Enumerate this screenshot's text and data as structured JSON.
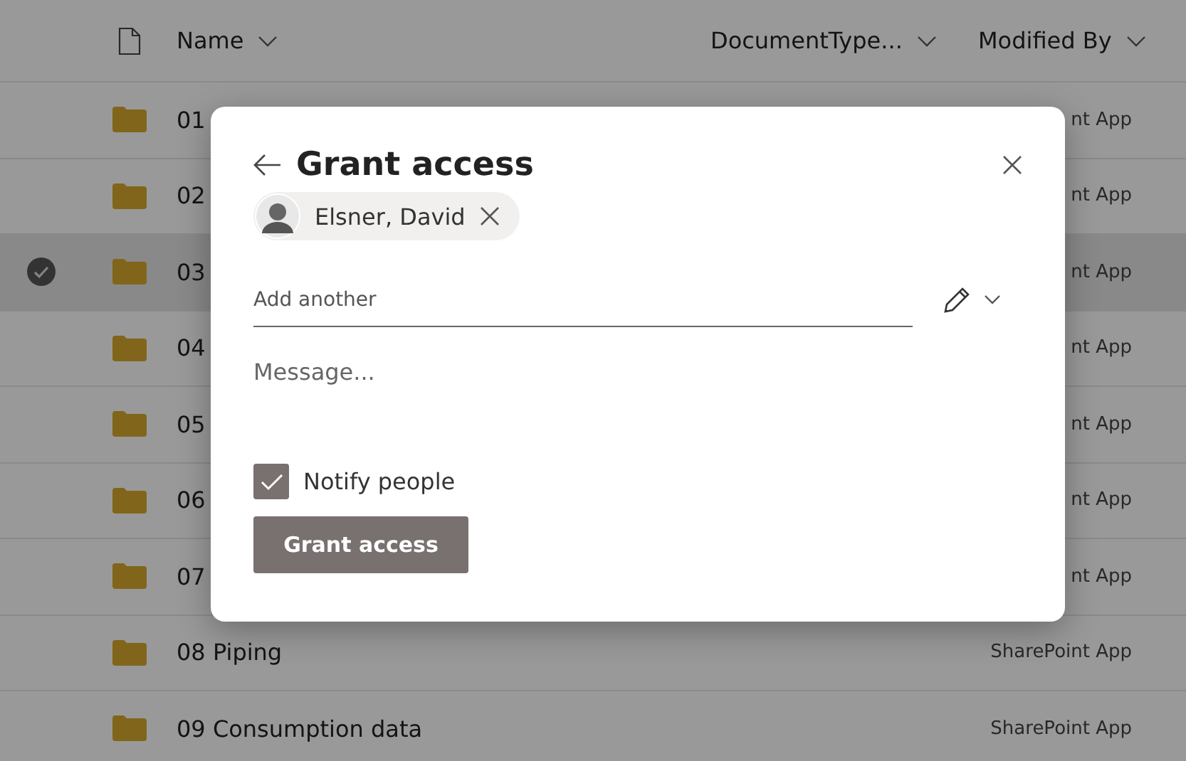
{
  "table": {
    "columns": [
      {
        "label": "Name"
      },
      {
        "label": "DocumentType..."
      },
      {
        "label": "Modified By"
      }
    ],
    "rows": [
      {
        "name": "01",
        "modified_by": "nt App",
        "selected": false
      },
      {
        "name": "02",
        "modified_by": "nt App",
        "selected": false
      },
      {
        "name": "03",
        "modified_by": "nt App",
        "selected": true
      },
      {
        "name": "04",
        "modified_by": "nt App",
        "selected": false
      },
      {
        "name": "05",
        "modified_by": "nt App",
        "selected": false
      },
      {
        "name": "06",
        "modified_by": "nt App",
        "selected": false
      },
      {
        "name": "07",
        "modified_by": "nt App",
        "selected": false
      },
      {
        "name": "08 Piping",
        "modified_by": "SharePoint App",
        "selected": false
      },
      {
        "name": "09 Consumption data",
        "modified_by": "SharePoint App",
        "selected": false
      }
    ]
  },
  "dialog": {
    "title": "Grant access",
    "people": [
      {
        "name": "Elsner, David"
      }
    ],
    "add_field": {
      "placeholder": "Add another"
    },
    "message_field": {
      "placeholder": "Message..."
    },
    "notify": {
      "label": "Notify people",
      "checked": true
    },
    "submit_button": "Grant access"
  }
}
